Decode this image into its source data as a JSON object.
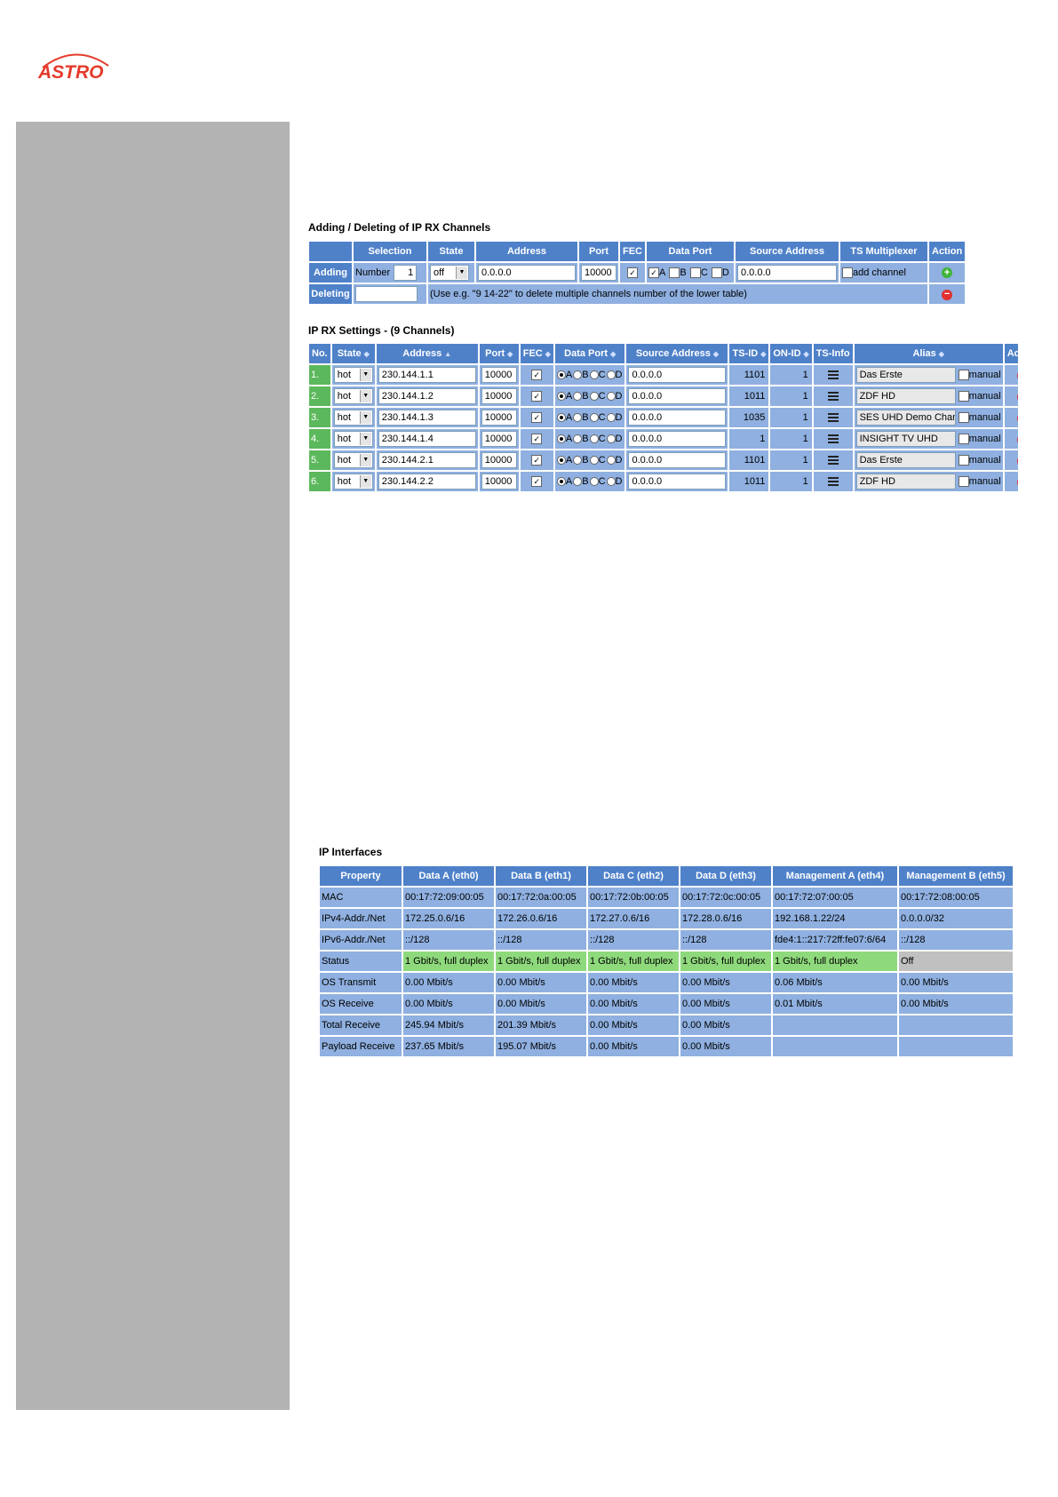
{
  "logo": {
    "text": "ASTRO",
    "color": "#e53b2c"
  },
  "colors": {
    "header": "#4f81c9",
    "cell": "#8fb0e0",
    "status_ok": "#8fd97d",
    "status_off": "#c0c0c0",
    "sidebar": "#b3b3b3",
    "row_no": "#5cb85c"
  },
  "adding": {
    "title": "Adding / Deleting of IP RX Channels",
    "headers": [
      "",
      "Selection",
      "State",
      "Address",
      "Port",
      "FEC",
      "Data Port",
      "Source Address",
      "TS Multiplexer",
      "Action"
    ],
    "adding_label": "Adding",
    "number_label": "Number",
    "number_value": "1",
    "state_value": "off",
    "address_value": "0.0.0.0",
    "port_value": "10000",
    "data_ports": [
      "A",
      "B",
      "C",
      "D"
    ],
    "source_value": "0.0.0.0",
    "mux_label": "add channel",
    "deleting_label": "Deleting",
    "delete_hint": "(Use e.g. \"9 14-22\" to delete multiple channels number of the lower table)"
  },
  "rx": {
    "title": "IP RX Settings - (9 Channels)",
    "headers": [
      "No.",
      "State",
      "Address",
      "Port",
      "FEC",
      "Data Port",
      "Source Address",
      "TS-ID",
      "ON-ID",
      "TS-Info",
      "Alias",
      "Action"
    ],
    "manual_label": "manual",
    "rows": [
      {
        "no": "1.",
        "state": "hot",
        "address": "230.144.1.1",
        "port": "10000",
        "source": "0.0.0.0",
        "tsid": "1101",
        "onid": "1",
        "alias": "Das Erste"
      },
      {
        "no": "2.",
        "state": "hot",
        "address": "230.144.1.2",
        "port": "10000",
        "source": "0.0.0.0",
        "tsid": "1011",
        "onid": "1",
        "alias": "ZDF HD"
      },
      {
        "no": "3.",
        "state": "hot",
        "address": "230.144.1.3",
        "port": "10000",
        "source": "0.0.0.0",
        "tsid": "1035",
        "onid": "1",
        "alias": "SES UHD Demo Channel"
      },
      {
        "no": "4.",
        "state": "hot",
        "address": "230.144.1.4",
        "port": "10000",
        "source": "0.0.0.0",
        "tsid": "1",
        "onid": "1",
        "alias": "INSIGHT TV UHD"
      },
      {
        "no": "5.",
        "state": "hot",
        "address": "230.144.2.1",
        "port": "10000",
        "source": "0.0.0.0",
        "tsid": "1101",
        "onid": "1",
        "alias": "Das Erste"
      },
      {
        "no": "6.",
        "state": "hot",
        "address": "230.144.2.2",
        "port": "10000",
        "source": "0.0.0.0",
        "tsid": "1011",
        "onid": "1",
        "alias": "ZDF HD"
      }
    ]
  },
  "interfaces": {
    "title": "IP Interfaces",
    "headers": [
      "Property",
      "Data A (eth0)",
      "Data B (eth1)",
      "Data C (eth2)",
      "Data D (eth3)",
      "Management A (eth4)",
      "Management B (eth5)"
    ],
    "rows": [
      {
        "label": "MAC",
        "cells": [
          "00:17:72:09:00:05",
          "00:17:72:0a:00:05",
          "00:17:72:0b:00:05",
          "00:17:72:0c:00:05",
          "00:17:72:07:00:05",
          "00:17:72:08:00:05"
        ]
      },
      {
        "label": "IPv4-Addr./Net",
        "cells": [
          "172.25.0.6/16",
          "172.26.0.6/16",
          "172.27.0.6/16",
          "172.28.0.6/16",
          "192.168.1.22/24",
          "0.0.0.0/32"
        ]
      },
      {
        "label": "IPv6-Addr./Net",
        "cells": [
          "::/128",
          "::/128",
          "::/128",
          "::/128",
          "fde4:1::217:72ff:fe07:6/64",
          "::/128"
        ]
      },
      {
        "label": "Status",
        "cells": [
          "1 Gbit/s, full duplex",
          "1 Gbit/s, full duplex",
          "1 Gbit/s, full duplex",
          "1 Gbit/s, full duplex",
          "1 Gbit/s, full duplex",
          "Off"
        ]
      },
      {
        "label": "OS Transmit",
        "cells": [
          "0.00 Mbit/s",
          "0.00 Mbit/s",
          "0.00 Mbit/s",
          "0.00 Mbit/s",
          "0.06 Mbit/s",
          "0.00 Mbit/s"
        ]
      },
      {
        "label": "OS Receive",
        "cells": [
          "0.00 Mbit/s",
          "0.00 Mbit/s",
          "0.00 Mbit/s",
          "0.00 Mbit/s",
          "0.01 Mbit/s",
          "0.00 Mbit/s"
        ]
      },
      {
        "label": "Total Receive",
        "cells": [
          "245.94 Mbit/s",
          "201.39 Mbit/s",
          "0.00 Mbit/s",
          "0.00 Mbit/s",
          "",
          ""
        ]
      },
      {
        "label": "Payload Receive",
        "cells": [
          "237.65 Mbit/s",
          "195.07 Mbit/s",
          "0.00 Mbit/s",
          "0.00 Mbit/s",
          "",
          ""
        ]
      }
    ]
  }
}
